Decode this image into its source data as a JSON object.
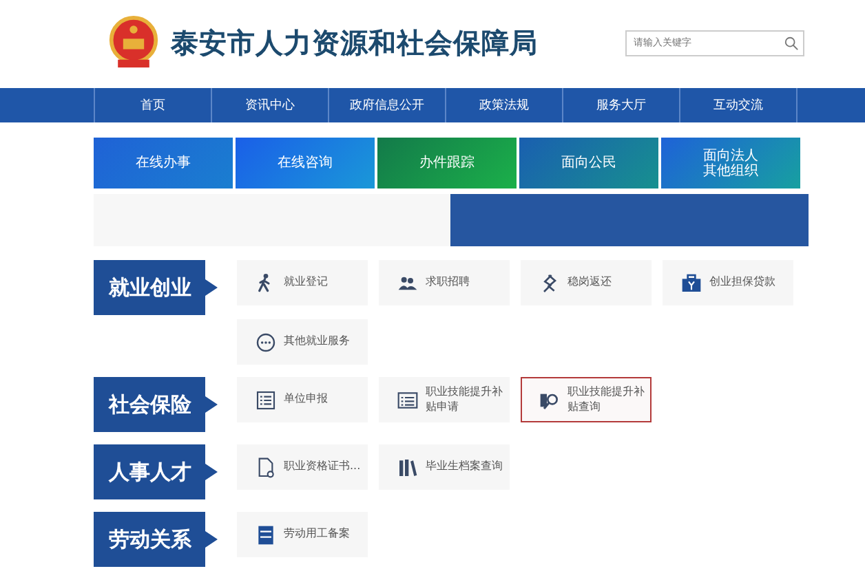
{
  "header": {
    "title": "泰安市人力资源和社会保障局",
    "search": {
      "placeholder": "请输入关键字"
    }
  },
  "nav": [
    "首页",
    "资讯中心",
    "政府信息公开",
    "政策法规",
    "服务大厅",
    "互动交流"
  ],
  "tiles": [
    "在线办事",
    "在线咨询",
    "办件跟踪",
    "面向公民",
    "面向法人其他组织"
  ],
  "categories": [
    {
      "label": "就业创业",
      "items": [
        {
          "label": "就业登记",
          "selected": false
        },
        {
          "label": "求职招聘",
          "selected": false
        },
        {
          "label": "稳岗返还",
          "selected": false
        },
        {
          "label": "创业担保贷款",
          "selected": false
        },
        {
          "label": "其他就业服务",
          "selected": false
        }
      ]
    },
    {
      "label": "社会保险",
      "items": [
        {
          "label": "单位申报",
          "selected": false
        },
        {
          "label": "职业技能提升补贴申请",
          "selected": false
        },
        {
          "label": "职业技能提升补贴查询",
          "selected": true
        }
      ]
    },
    {
      "label": "人事人才",
      "items": [
        {
          "label": "职业资格证书...",
          "selected": false
        },
        {
          "label": "毕业生档案查询",
          "selected": false
        }
      ]
    },
    {
      "label": "劳动关系",
      "items": [
        {
          "label": "劳动用工备案",
          "selected": false
        }
      ]
    }
  ]
}
